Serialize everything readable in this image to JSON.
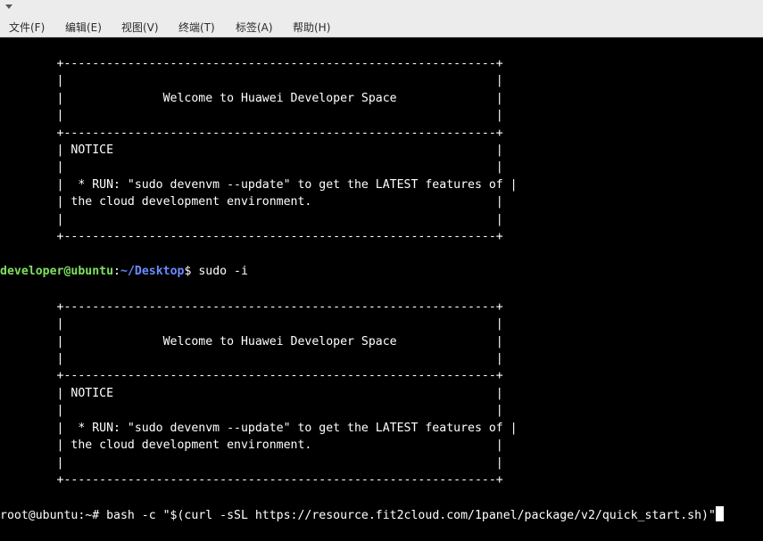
{
  "menubar": {
    "items": [
      {
        "label": "文件(F)"
      },
      {
        "label": "编辑(E)"
      },
      {
        "label": "视图(V)"
      },
      {
        "label": "终端(T)"
      },
      {
        "label": "标签(A)"
      },
      {
        "label": "帮助(H)"
      }
    ]
  },
  "terminal": {
    "banner1": [
      "        +-------------------------------------------------------------+",
      "        |                                                             |",
      "        |              Welcome to Huawei Developer Space              |",
      "        |                                                             |",
      "        +-------------------------------------------------------------+",
      "        | NOTICE                                                      |",
      "        |                                                             |",
      "        |  * RUN: \"sudo devenvm --update\" to get the LATEST features of |",
      "        | the cloud development environment.                          |",
      "        |                                                             |",
      "        +-------------------------------------------------------------+"
    ],
    "prompt1": {
      "user": "developer@ubuntu",
      "sep": ":",
      "path": "~/Desktop",
      "symbol": "$ ",
      "command": "sudo -i"
    },
    "banner2": [
      "        +-------------------------------------------------------------+",
      "        |                                                             |",
      "        |              Welcome to Huawei Developer Space              |",
      "        |                                                             |",
      "        +-------------------------------------------------------------+",
      "        | NOTICE                                                      |",
      "        |                                                             |",
      "        |  * RUN: \"sudo devenvm --update\" to get the LATEST features of |",
      "        | the cloud development environment.                          |",
      "        |                                                             |",
      "        +-------------------------------------------------------------+"
    ],
    "prompt2": {
      "prefix": "root@ubuntu:~# ",
      "command": "bash -c \"$(curl -sSL https://resource.fit2cloud.com/1panel/package/v2/quick_start.sh)\""
    }
  },
  "colors": {
    "background": "#000000",
    "text": "#ffffff",
    "user": "#7fe060",
    "path": "#6a8cff",
    "menubar": "#ececec"
  }
}
